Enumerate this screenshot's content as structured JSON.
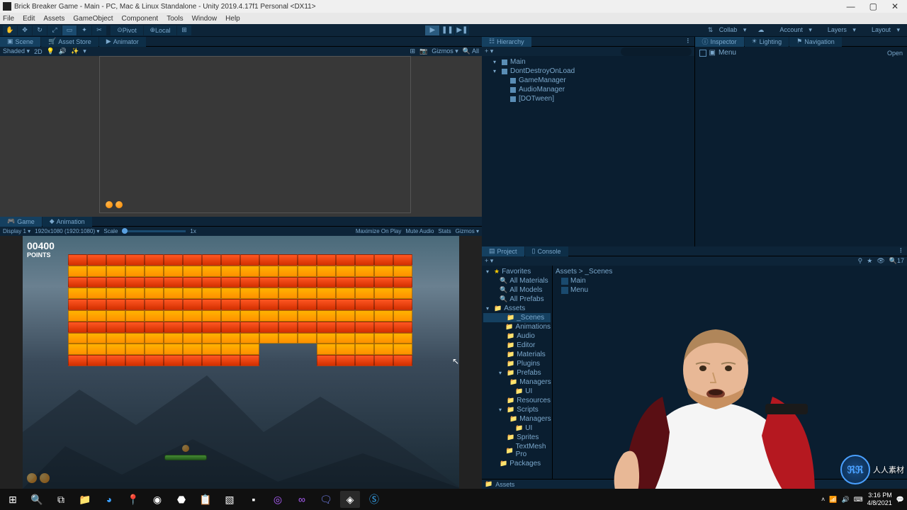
{
  "window": {
    "title": "Brick Breaker Game - Main - PC, Mac & Linux Standalone - Unity 2019.4.17f1 Personal <DX11>"
  },
  "menu": [
    "File",
    "Edit",
    "Assets",
    "GameObject",
    "Component",
    "Tools",
    "Window",
    "Help"
  ],
  "toolbar": {
    "pivot": "Pivot",
    "local": "Local",
    "collab": "Collab",
    "account": "Account",
    "layers": "Layers",
    "layout": "Layout"
  },
  "scene": {
    "tab_scene": "Scene",
    "tab_asset_store": "Asset Store",
    "tab_animator": "Animator",
    "shaded": "Shaded",
    "twoD": "2D",
    "gizmos": "Gizmos",
    "all": "All"
  },
  "game": {
    "tab_game": "Game",
    "tab_animation": "Animation",
    "display": "Display 1",
    "resolution": "1920x1080 (1920:1080)",
    "scale": "Scale",
    "scale_value": "1x",
    "maximize": "Maximize On Play",
    "mute": "Mute Audio",
    "stats": "Stats",
    "gizmos": "Gizmos",
    "score": "00400",
    "points": "POINTS",
    "bricks": {
      "cols": 18,
      "rows": 10,
      "pattern": [
        "red",
        "orange",
        "red",
        "orange",
        "red",
        "orange",
        "red",
        "orange",
        "orange",
        "red"
      ],
      "missing": [
        [
          8,
          10
        ],
        [
          8,
          11
        ],
        [
          8,
          12
        ],
        [
          9,
          10
        ],
        [
          9,
          11
        ],
        [
          9,
          12
        ]
      ]
    }
  },
  "hierarchy": {
    "tab": "Hierarchy",
    "items": [
      {
        "label": "Main",
        "depth": 1,
        "icon": "unity"
      },
      {
        "label": "DontDestroyOnLoad",
        "depth": 1,
        "icon": "unity"
      },
      {
        "label": "GameManager",
        "depth": 2,
        "icon": "cube"
      },
      {
        "label": "AudioManager",
        "depth": 2,
        "icon": "cube"
      },
      {
        "label": "[DOTween]",
        "depth": 2,
        "icon": "cube"
      }
    ]
  },
  "inspector": {
    "tab_inspector": "Inspector",
    "tab_lighting": "Lighting",
    "tab_navigation": "Navigation",
    "object": "Menu",
    "open": "Open"
  },
  "project": {
    "tab_project": "Project",
    "tab_console": "Console",
    "slider": "17",
    "favorites": "Favorites",
    "fav_items": [
      "All Materials",
      "All Models",
      "All Prefabs"
    ],
    "assets": "Assets",
    "folders": [
      {
        "name": "_Scenes",
        "sel": true,
        "ind": 2
      },
      {
        "name": "Animations",
        "ind": 2
      },
      {
        "name": "Audio",
        "ind": 2
      },
      {
        "name": "Editor",
        "ind": 2
      },
      {
        "name": "Materials",
        "ind": 2
      },
      {
        "name": "Plugins",
        "ind": 2
      },
      {
        "name": "Prefabs",
        "ind": 2,
        "open": true
      },
      {
        "name": "Managers",
        "ind": 3
      },
      {
        "name": "UI",
        "ind": 3
      },
      {
        "name": "Resources",
        "ind": 2
      },
      {
        "name": "Scripts",
        "ind": 2,
        "open": true
      },
      {
        "name": "Managers",
        "ind": 3
      },
      {
        "name": "UI",
        "ind": 3
      },
      {
        "name": "Sprites",
        "ind": 2
      },
      {
        "name": "TextMesh Pro",
        "ind": 2
      },
      {
        "name": "Packages",
        "ind": 1
      }
    ],
    "breadcrumb": "Assets > _Scenes",
    "items": [
      "Main",
      "Menu"
    ],
    "footer": "Assets"
  },
  "taskbar": {
    "time": "3:16 PM",
    "date": "4/8/2021"
  },
  "watermark": {
    "text": "人人素材"
  }
}
